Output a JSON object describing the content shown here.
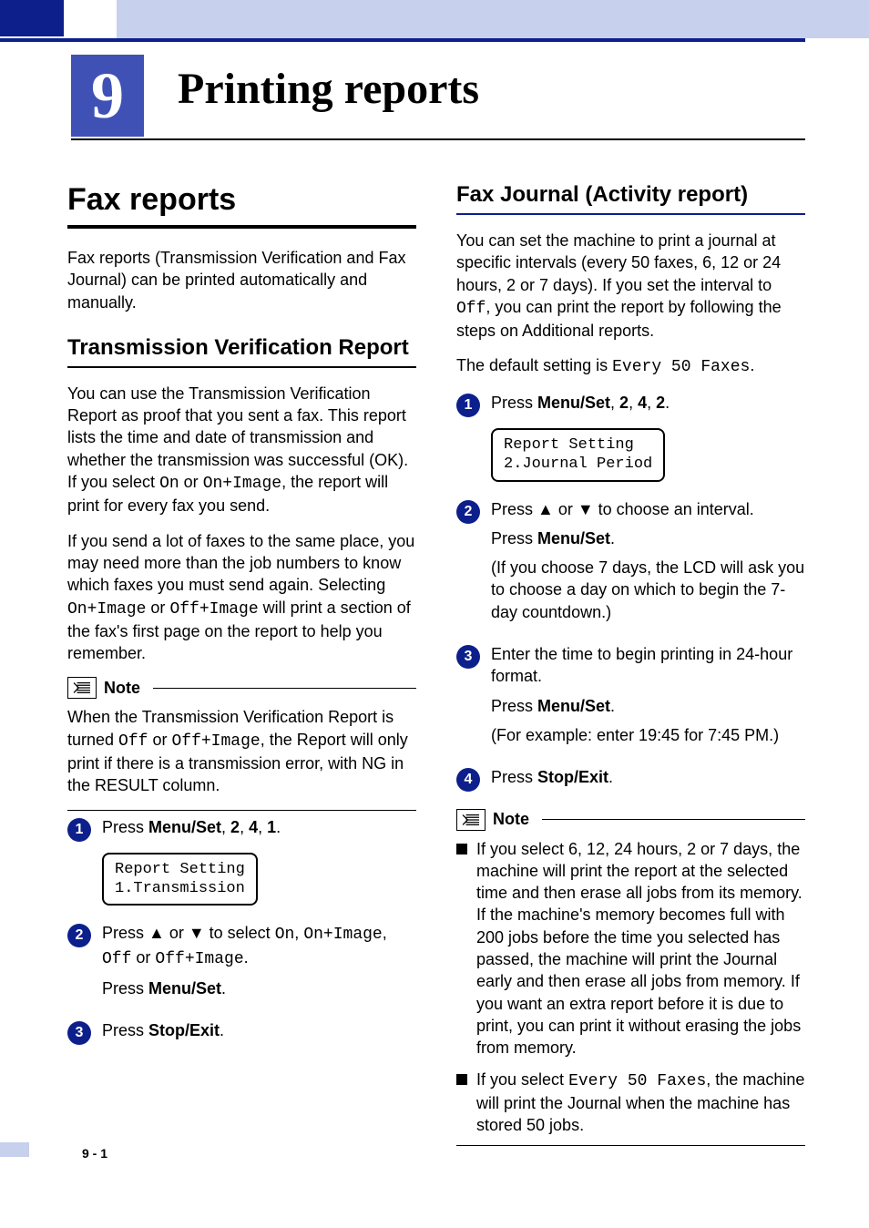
{
  "chapter": {
    "number": "9",
    "title": "Printing reports"
  },
  "left": {
    "h1": "Fax reports",
    "intro": "Fax reports (Transmission Verification and Fax Journal) can be printed automatically and manually.",
    "sub1_title": "Transmission Verification Report",
    "sub1_p1_a": "You can use the Transmission Verification Report as proof that you sent a fax. This report lists the time and date of transmission and whether the transmission was successful (OK). If you select ",
    "sub1_p1_code1": "On",
    "sub1_p1_b": " or ",
    "sub1_p1_code2": "On+Image",
    "sub1_p1_c": ", the report will print for every fax you send.",
    "sub1_p2_a": "If you send a lot of faxes to the same place, you may need more than the job numbers to know which faxes you must send again. Selecting ",
    "sub1_p2_code1": "On+Image",
    "sub1_p2_b": " or ",
    "sub1_p2_code2": "Off+Image",
    "sub1_p2_c": " will print a section of the fax's first page on the report to help you remember.",
    "note_label": "Note",
    "note_a": "When the Transmission Verification Report is turned ",
    "note_code1": "Off",
    "note_b": " or ",
    "note_code2": "Off+Image",
    "note_c": ", the Report will only print if there is a transmission error, with NG in the RESULT column.",
    "step1_a": "Press ",
    "step1_b_bold": "Menu/Set",
    "step1_c": ", ",
    "step1_d_bold": "2",
    "step1_e": ", ",
    "step1_f_bold": "4",
    "step1_g": ", ",
    "step1_h_bold": "1",
    "step1_i": ".",
    "lcd1": "Report Setting\n1.Transmission",
    "step2_a": "Press ▲ or ▼ to select ",
    "step2_code1": "On",
    "step2_b": ", ",
    "step2_code2": "On+Image",
    "step2_c": ", ",
    "step2_code3": "Off",
    "step2_d": " or ",
    "step2_code4": "Off+Image",
    "step2_e": ".",
    "step2_press": "Press ",
    "step2_press_bold": "Menu/Set",
    "step2_press_end": ".",
    "step3_a": "Press ",
    "step3_b_bold": "Stop/Exit",
    "step3_c": "."
  },
  "right": {
    "sub_title": "Fax Journal (Activity report)",
    "p1_a": "You can set the machine to print a journal at specific intervals (every 50 faxes, 6, 12 or 24 hours, 2 or 7 days). If you set the interval to ",
    "p1_code": "Off",
    "p1_b": ", you can print the report by following the steps on Additional reports.",
    "p2_a": "The default setting is ",
    "p2_code": "Every 50 Faxes",
    "p2_b": ".",
    "step1_a": "Press ",
    "step1_b_bold": "Menu/Set",
    "step1_c": ", ",
    "step1_d_bold": "2",
    "step1_e": ", ",
    "step1_f_bold": "4",
    "step1_g": ", ",
    "step1_h_bold": "2",
    "step1_i": ".",
    "lcd1": "Report Setting\n2.Journal Period",
    "step2_a": "Press ▲ or ▼ to choose an interval.",
    "step2_b_press": "Press ",
    "step2_b_bold": "Menu/Set",
    "step2_b_end": ".",
    "step2_c": "(If you choose 7 days, the LCD will ask you to choose a day on which to begin the 7-day countdown.)",
    "step3_a": "Enter the time to begin printing in 24-hour format.",
    "step3_b_press": "Press ",
    "step3_b_bold": "Menu/Set",
    "step3_b_end": ".",
    "step3_c": "(For example: enter 19:45 for 7:45 PM.)",
    "step4_a": "Press ",
    "step4_b_bold": "Stop/Exit",
    "step4_c": ".",
    "note_label": "Note",
    "nb1_a": "If you select 6, 12, 24 hours, 2 or 7 days, the machine will print the report at the selected time and then erase all jobs from its memory. If the machine's memory becomes full with 200 jobs before the time you selected has passed, the machine will print the Journal early and then erase all jobs from memory. If you want an extra report before it is due to print, you can print it without erasing the jobs from memory.",
    "nb2_a": "If you select ",
    "nb2_code": "Every 50 Faxes",
    "nb2_b": ", the machine will print the Journal when the machine has stored 50 jobs."
  },
  "page_number": "9 - 1"
}
